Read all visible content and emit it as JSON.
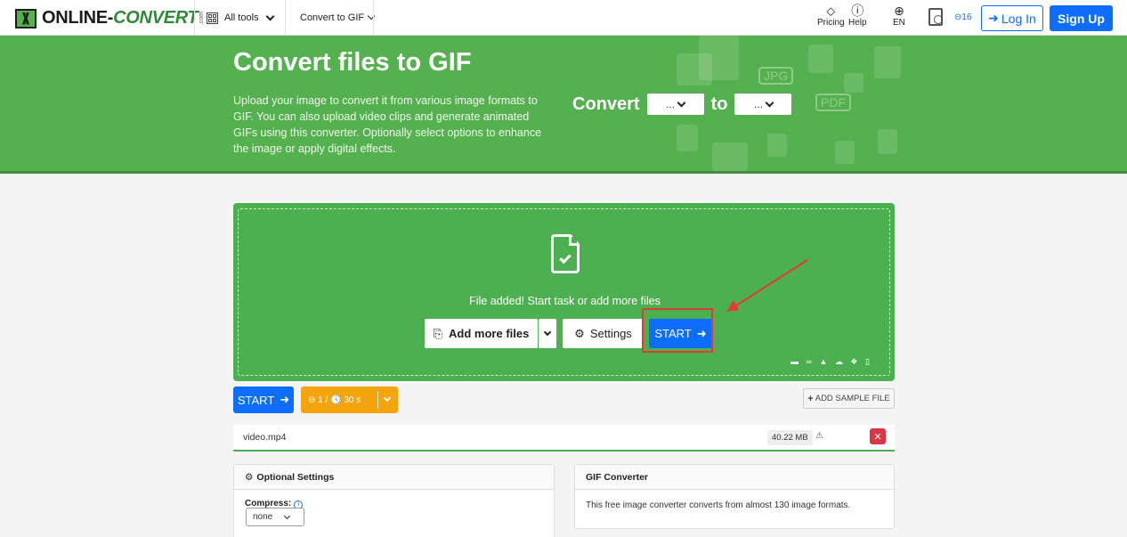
{
  "header": {
    "logo_text_a": "ONLINE-",
    "logo_text_b": "CONVERT",
    "logo_com": ".com",
    "all_tools": "All tools",
    "convert_to": "Convert to GIF",
    "pricing": "Pricing",
    "help": "Help",
    "lang": "EN",
    "credits": "16",
    "login": "Log In",
    "signup": "Sign Up"
  },
  "hero": {
    "title": "Convert files to GIF",
    "description": "Upload your image to convert it from various image formats to GIF. You can also upload video clips and generate animated GIFs using this converter. Optionally select options to enhance the image or apply digital effects.",
    "convert_word": "Convert",
    "to_word": "to",
    "from_value": "...",
    "to_value": "..."
  },
  "upload": {
    "status": "File added! Start task or add more files",
    "add_more": "Add more files",
    "settings": "Settings",
    "start": "START"
  },
  "toolbar": {
    "start": "START",
    "credit_usage": "1 / ",
    "time_limit": "30 s",
    "add_sample": "ADD SAMPLE FILE"
  },
  "file": {
    "name": "video.mp4",
    "size": "40.22 MB"
  },
  "optional_settings": {
    "title": "Optional Settings",
    "compress_label": "Compress:",
    "compress_value": "none"
  },
  "gif_converter": {
    "title": "GIF Converter",
    "text": "This free image converter converts from almost 130 image formats."
  }
}
